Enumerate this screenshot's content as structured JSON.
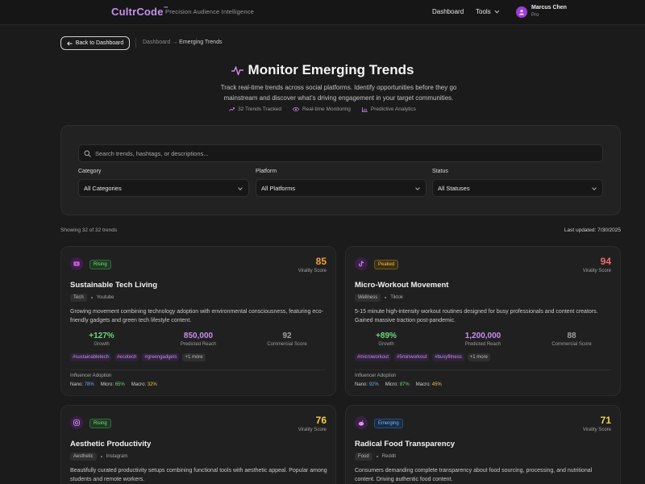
{
  "header": {
    "brand": "CultrCode",
    "brand_mark": "™",
    "tagline": "Precision Audience Intelligence",
    "nav_dashboard": "Dashboard",
    "nav_tools": "Tools",
    "user_name": "Marcus Chen",
    "user_plan": "Pro"
  },
  "page": {
    "back_label": "Back to Dashboard",
    "breadcrumb_root": "Dashboard",
    "breadcrumb_arrow": "→",
    "breadcrumb_current": "Emerging Trends",
    "title": "Monitor Emerging Trends",
    "description": "Track real-time trends across social platforms. Identify opportunities before they go mainstream and discover what's driving engagement in your target communities.",
    "stats": [
      "32 Trends Tracked",
      "Real-time Monitoring",
      "Predictive Analytics"
    ]
  },
  "filters": {
    "search_placeholder": "Search trends, hashtags, or descriptions...",
    "category_label": "Category",
    "category_value": "All Categories",
    "platform_label": "Platform",
    "platform_value": "All Platforms",
    "status_label": "Status",
    "status_value": "All Statuses"
  },
  "results": {
    "showing": "Showing 32 of 32 trends",
    "updated": "Last updated: 7/30/2025"
  },
  "colors": {
    "accent": "#c78ef0",
    "score_orange": "#f0a13c",
    "score_red": "#f06a6a",
    "score_yellow": "#f2d04b"
  },
  "cards": [
    {
      "icon": "youtube-icon",
      "status": "Rising",
      "score": "85",
      "score_label": "Virality Score",
      "title": "Sustainable Tech Living",
      "category": "Tech",
      "platform": "Youtube",
      "description": "Growing movement combining technology adoption with environmental consciousness, featuring eco-friendly gadgets and green tech lifestyle content.",
      "growth": "+127%",
      "growth_label": "Growth",
      "reach": "850,000",
      "reach_label": "Predicted Reach",
      "commercial": "92",
      "commercial_label": "Commercial Score",
      "hashtags": [
        "#sustainabletech",
        "#ecotech",
        "#greengadgets"
      ],
      "more": "+1 more",
      "adoption_title": "Influencer Adoption",
      "nano_label": "Nano:",
      "nano": "78%",
      "micro_label": "Micro:",
      "micro": "65%",
      "macro_label": "Macro:",
      "macro": "32%"
    },
    {
      "icon": "tiktok-icon",
      "status": "Peaked",
      "score": "94",
      "score_label": "Virality Score",
      "title": "Micro-Workout Movement",
      "category": "Wellness",
      "platform": "Tiktok",
      "description": "5-15 minute high-intensity workout routines designed for busy professionals and content creators. Gained massive traction post-pandemic.",
      "growth": "+89%",
      "growth_label": "Growth",
      "reach": "1,200,000",
      "reach_label": "Predicted Reach",
      "commercial": "88",
      "commercial_label": "Commercial Score",
      "hashtags": [
        "#microworkout",
        "#5minworkout",
        "#busyfitness"
      ],
      "more": "+1 more",
      "adoption_title": "Influencer Adoption",
      "nano_label": "Nano:",
      "nano": "92%",
      "micro_label": "Micro:",
      "micro": "87%",
      "macro_label": "Macro:",
      "macro": "45%"
    },
    {
      "icon": "instagram-icon",
      "status": "Rising",
      "score": "76",
      "score_label": "Virality Score",
      "title": "Aesthetic Productivity",
      "category": "Aesthetic",
      "platform": "Instagram",
      "description": "Beautifully curated productivity setups combining functional tools with aesthetic appeal. Popular among students and remote workers."
    },
    {
      "icon": "reddit-icon",
      "status": "Emerging",
      "score": "71",
      "score_label": "Virality Score",
      "title": "Radical Food Transparency",
      "category": "Food",
      "platform": "Reddit",
      "description": "Consumers demanding complete transparency about food sourcing, processing, and nutritional content. Driving authentic food content."
    }
  ]
}
